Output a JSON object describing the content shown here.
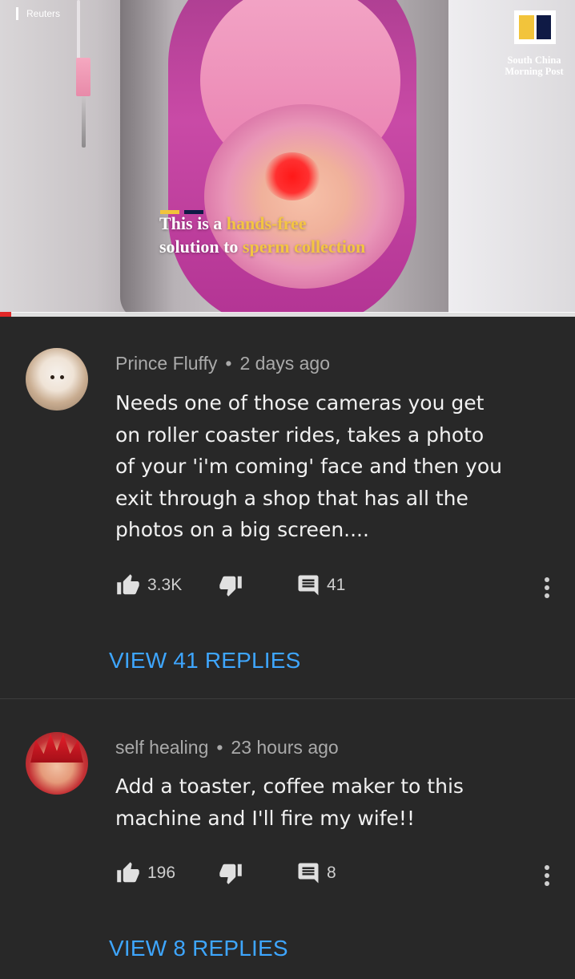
{
  "video": {
    "source_label": "Reuters",
    "publisher": "South China Morning Post",
    "publisher_line1": "South China",
    "publisher_line2": "Morning Post",
    "caption": {
      "line1_plain": "This is a ",
      "line1_highlight": "hands-free",
      "line2_plain": "solution to ",
      "line2_highlight": "sperm collection"
    },
    "progress_fraction": 0.02,
    "colors": {
      "caption_highlight": "#f4c542",
      "bar_yellow": "#f2c43b",
      "bar_navy": "#0f1a45",
      "progress": "#e22727"
    }
  },
  "comments": [
    {
      "author": "Prince Fluffy",
      "separator": "•",
      "time": "2 days ago",
      "lines": [
        "Needs one of those cameras you get",
        "on roller coaster rides, takes a photo",
        "of your 'i'm coming' face and then you",
        "exit through a shop that has all the",
        "photos on a big screen...."
      ],
      "likes": "3.3K",
      "reply_count": "41",
      "view_replies": "VIEW 41 REPLIES",
      "avatar_icon": "dog-avatar"
    },
    {
      "author": "self healing",
      "separator": "•",
      "time": "23 hours ago",
      "lines": [
        "Add a toaster, coffee maker to this",
        "machine and I'll fire my wife!!"
      ],
      "likes": "196",
      "reply_count": "8",
      "view_replies": "VIEW 8 REPLIES",
      "avatar_icon": "anime-avatar"
    }
  ],
  "colors": {
    "background": "#282828",
    "link": "#3ea6ff",
    "meta": "#aaaaaa",
    "text": "#f1f1f1"
  }
}
